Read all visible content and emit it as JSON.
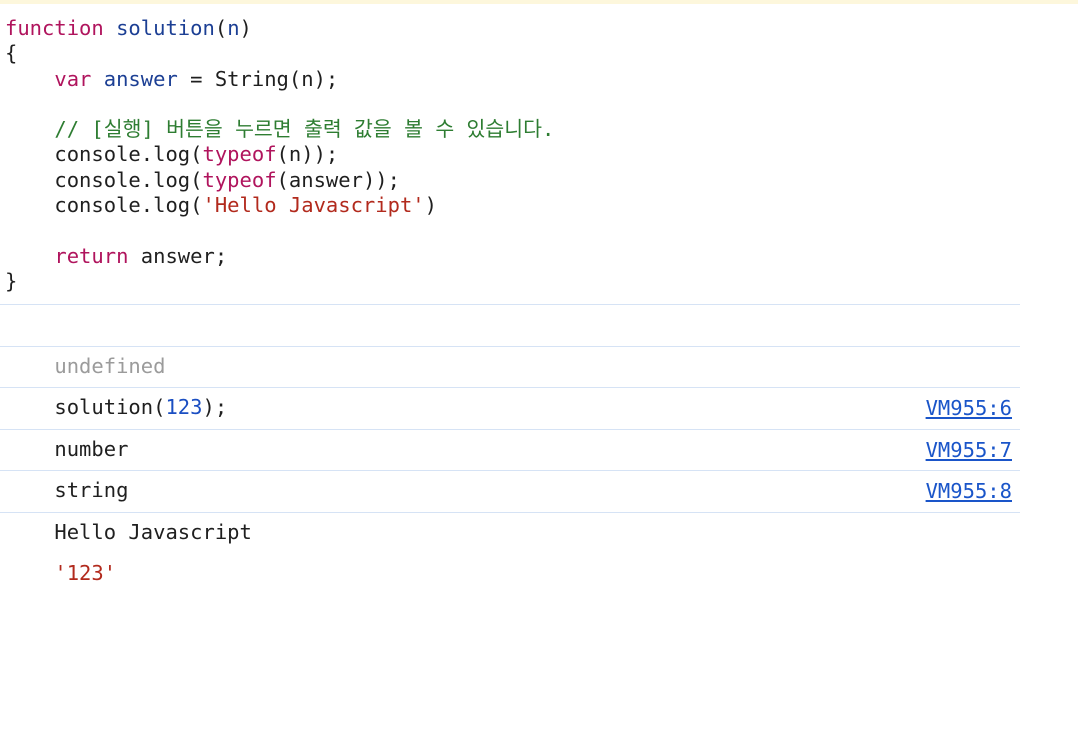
{
  "code": {
    "line1": {
      "kw": "function",
      "sp": " ",
      "fn": "solution",
      "open": "(",
      "param": "n",
      "close": ")"
    },
    "line2": "{",
    "line3": {
      "indent": "    ",
      "kw": "var",
      "sp": " ",
      "ident": "answer",
      "rest": " = String(n);"
    },
    "line4": "",
    "line5": {
      "indent": "    ",
      "comment": "// [실행] 버튼을 누르면 출력 값을 볼 수 있습니다."
    },
    "line6": {
      "indent": "    ",
      "pre": "console.log(",
      "kw": "typeof",
      "post": "(n));"
    },
    "line7": {
      "indent": "    ",
      "pre": "console.log(",
      "kw": "typeof",
      "post": "(answer));"
    },
    "line8": {
      "indent": "    ",
      "pre": "console.log(",
      "str": "'Hello Javascript'",
      "post": ")"
    },
    "line9": "",
    "line10": {
      "indent": "    ",
      "kw": "return",
      "rest": " answer;"
    },
    "line11": "}"
  },
  "console": {
    "result_undefined": "undefined",
    "input": {
      "pre": "solution(",
      "num": "123",
      "post": ");"
    },
    "logs": [
      {
        "text": "number",
        "source": "VM955:6"
      },
      {
        "text": "string",
        "source": "VM955:7"
      },
      {
        "text": "Hello Javascript",
        "source": "VM955:8"
      }
    ],
    "return_value": "'123'"
  },
  "colors": {
    "keyword": "#b0145d",
    "function_name": "#1c3f94",
    "string": "#b22a1d",
    "comment": "#2e7d32",
    "number": "#1a4ec2",
    "link": "#1a55c9",
    "separator": "#d6e3f5"
  }
}
